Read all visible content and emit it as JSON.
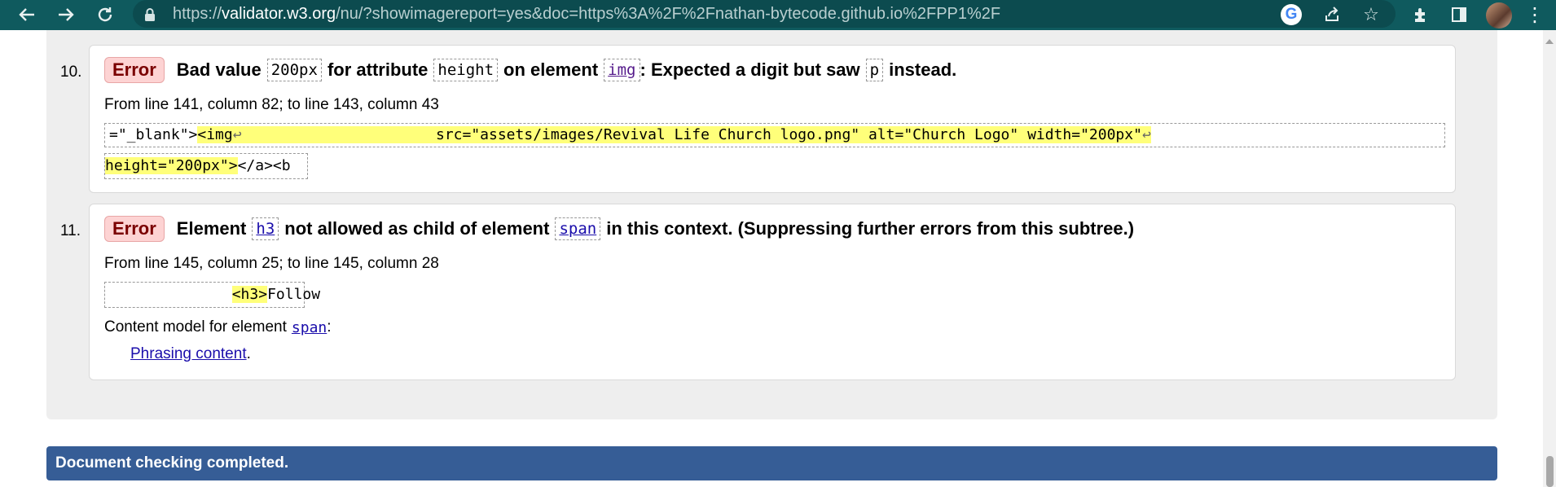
{
  "browser": {
    "url_prefix": "https://",
    "url_host": "validator.w3.org",
    "url_rest": "/nu/?showimagereport=yes&doc=https%3A%2F%2Fnathan-bytecode.github.io%2FPP1%2F",
    "icons": [
      "back-icon",
      "forward-icon",
      "reload-icon",
      "lock-icon",
      "google-icon",
      "share-icon",
      "star-icon",
      "extensions-icon",
      "sidepanel-icon",
      "avatar",
      "menu-icon"
    ]
  },
  "errors": [
    {
      "number": "10.",
      "badge": "Error",
      "msg_1": "Bad value",
      "code_1": "200px",
      "msg_2": "for attribute",
      "code_2": "height",
      "msg_3": "on element",
      "code_3": "img",
      "msg_4": ": Expected a digit but saw",
      "code_4": "p",
      "msg_5": "instead.",
      "location": "From line 141, column 82; to line 143, column 43",
      "extract_pre": "=\"_blank\">",
      "extract_hl_1": "<img",
      "extract_ret": "↩",
      "extract_hl_2": "                      src=\"assets/images/Revival Life Church logo.png\" alt=\"Church Logo\" width=\"200px\"",
      "extract_hl_3": "height=\"200px\">",
      "extract_post": "</a><b"
    },
    {
      "number": "11.",
      "badge": "Error",
      "msg_1": "Element",
      "code_1": "h3",
      "msg_2": "not allowed as child of element",
      "code_2": "span",
      "msg_3": "in this context. (Suppressing further errors from this subtree.)",
      "location": "From line 145, column 25; to line 145, column 28",
      "extract_pre": "              ",
      "extract_hl": "<h3>",
      "extract_post": "Follow",
      "model_label": "Content model for element",
      "model_element": "span",
      "model_colon": ":",
      "model_link": "Phrasing content",
      "model_period": "."
    }
  ],
  "footer": {
    "status": "Document checking completed."
  }
}
